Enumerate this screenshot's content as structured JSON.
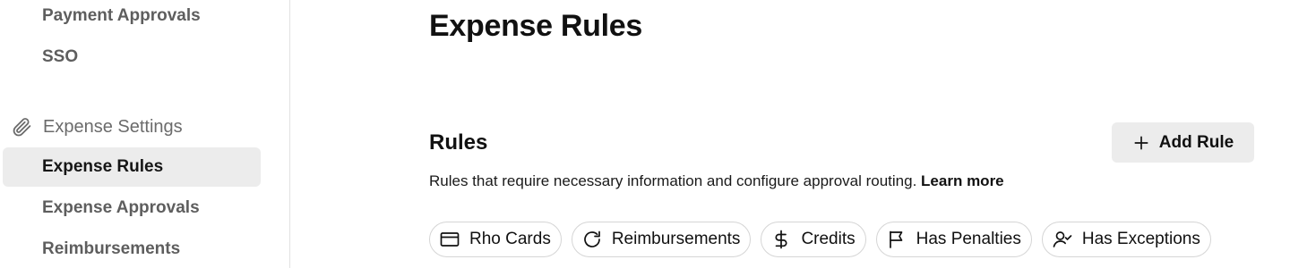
{
  "sidebar": {
    "items_top": [
      {
        "label": "Payment Approvals"
      },
      {
        "label": "SSO"
      }
    ],
    "section": {
      "label": "Expense Settings",
      "icon": "paperclip-icon"
    },
    "items": [
      {
        "label": "Expense Rules",
        "active": true
      },
      {
        "label": "Expense Approvals",
        "active": false
      },
      {
        "label": "Reimbursements",
        "active": false
      }
    ]
  },
  "main": {
    "page_title": "Expense Rules",
    "rules": {
      "title": "Rules",
      "add_button": {
        "label": "Add Rule",
        "icon": "plus-icon"
      },
      "description": "Rules that require necessary information and configure approval routing.",
      "learn_more": "Learn more",
      "filters": [
        {
          "label": "Rho Cards",
          "icon": "credit-card-icon"
        },
        {
          "label": "Reimbursements",
          "icon": "refresh-icon"
        },
        {
          "label": "Credits",
          "icon": "dollar-icon"
        },
        {
          "label": "Has Penalties",
          "icon": "flag-icon"
        },
        {
          "label": "Has Exceptions",
          "icon": "user-check-icon"
        }
      ]
    }
  }
}
